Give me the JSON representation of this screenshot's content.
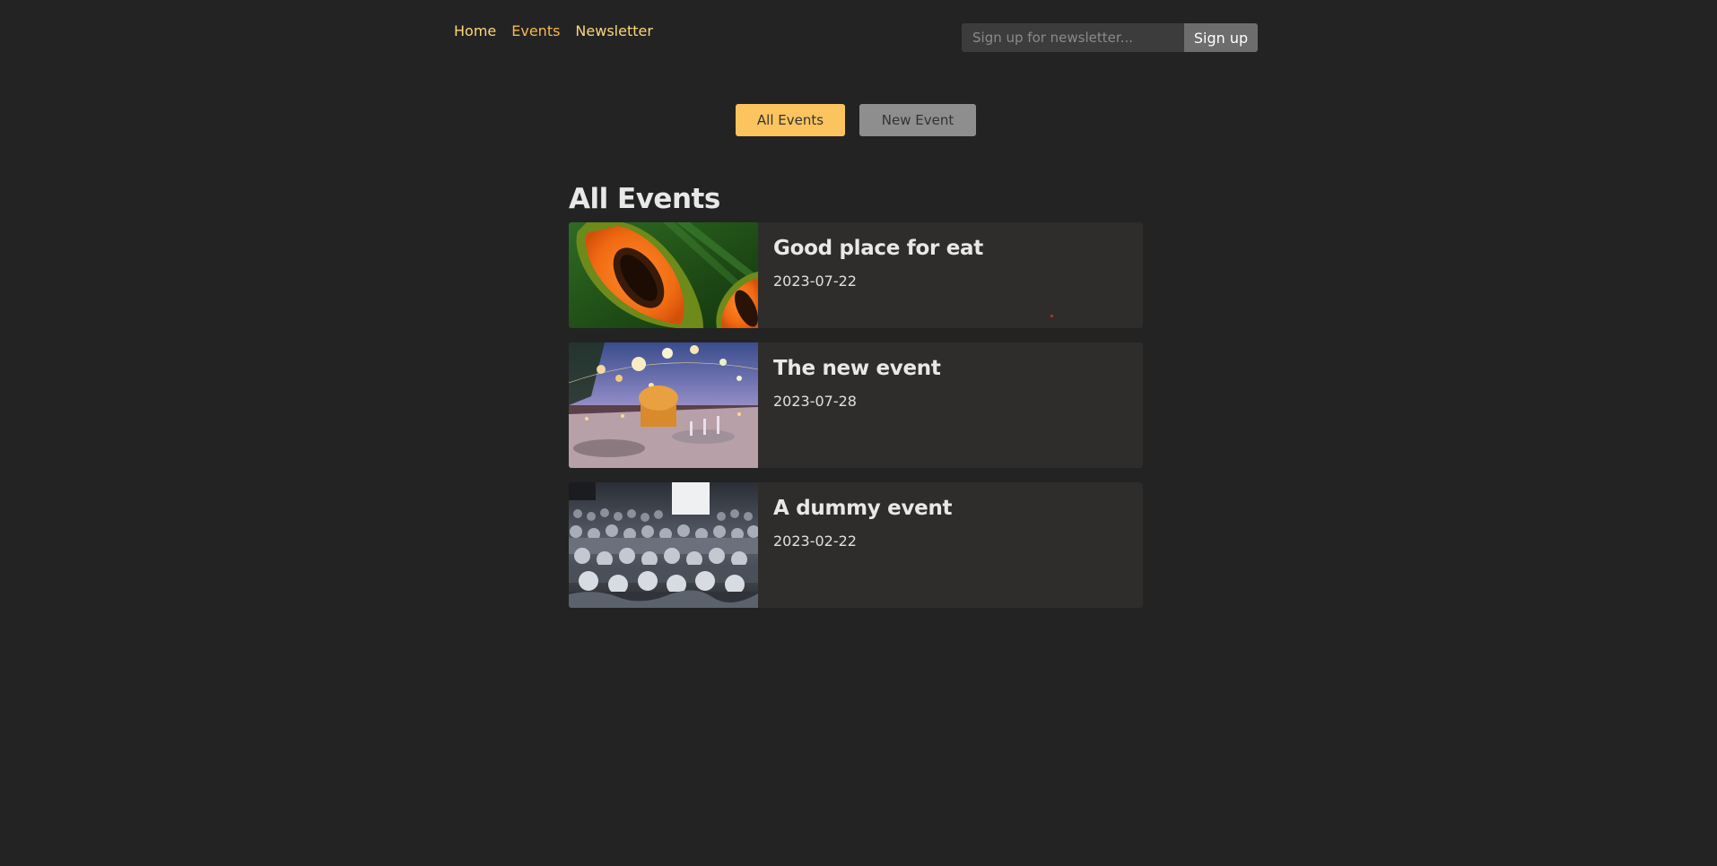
{
  "nav": {
    "items": [
      {
        "label": "Home",
        "active": false
      },
      {
        "label": "Events",
        "active": true
      },
      {
        "label": "Newsletter",
        "active": false
      }
    ]
  },
  "newsletter": {
    "placeholder": "Sign up for newsletter...",
    "button_label": "Sign up"
  },
  "tabs": {
    "all_label": "All Events",
    "new_label": "New Event"
  },
  "events_section": {
    "title": "All Events",
    "items": [
      {
        "title": "Good place for eat",
        "date": "2023-07-22"
      },
      {
        "title": "The new event",
        "date": "2023-07-28"
      },
      {
        "title": "A dummy event",
        "date": "2023-02-22"
      }
    ]
  },
  "colors": {
    "background": "#232323",
    "accent": "#fcc45e",
    "nav_link": "#fcd77a",
    "card": "#2f2d2c"
  }
}
